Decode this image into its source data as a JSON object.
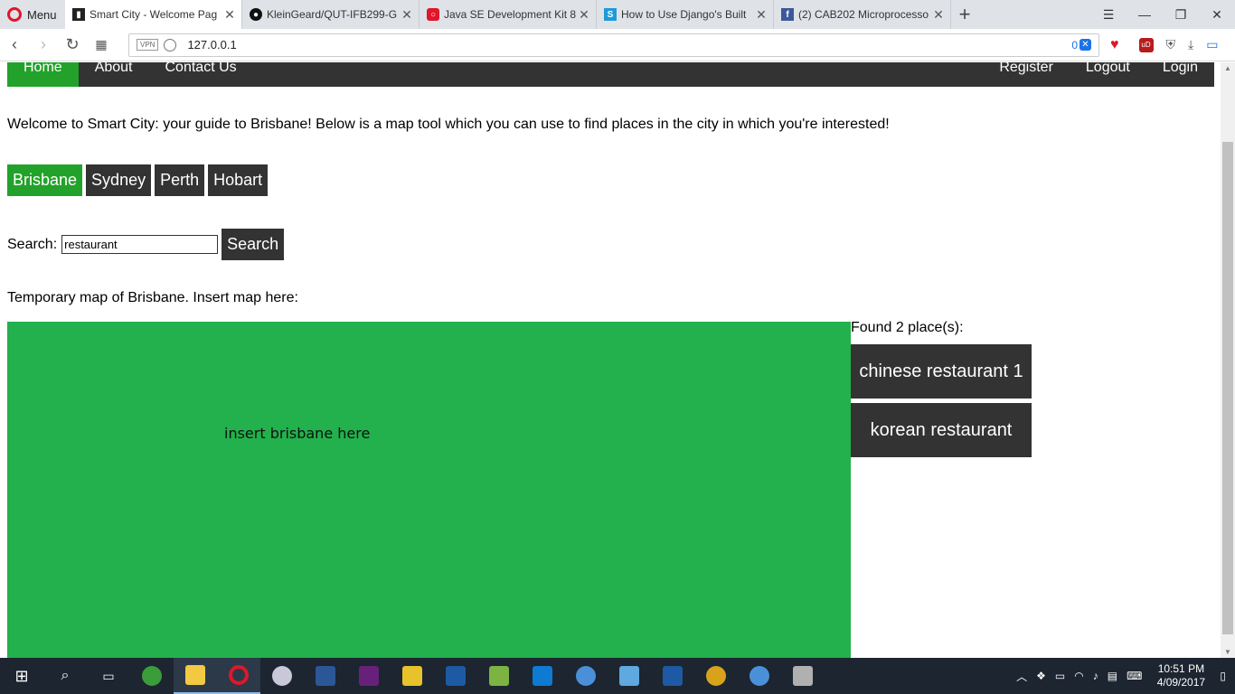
{
  "browser": {
    "menu_label": "Menu",
    "tabs": [
      {
        "title": "Smart City - Welcome Pag",
        "favicon_color": "#222222",
        "active": true
      },
      {
        "title": "KleinGeard/QUT-IFB299-G",
        "favicon_color": "#111111",
        "active": false
      },
      {
        "title": "Java SE Development Kit 8",
        "favicon_color": "#e0162b",
        "active": false
      },
      {
        "title": "How to Use Django's Built",
        "favicon_color": "#1e9bd7",
        "active": false
      },
      {
        "title": "(2) CAB202 Microprocesso",
        "favicon_color": "#3b5998",
        "active": false
      }
    ],
    "url": "127.0.0.1",
    "vpn_label": "VPN",
    "tracker_count": "0"
  },
  "page": {
    "nav": {
      "left": [
        "Home",
        "About",
        "Contact Us"
      ],
      "right": [
        "Register",
        "Logout",
        "Login"
      ]
    },
    "welcome_text": "Welcome to Smart City: your guide to Brisbane! Below is a map tool which you can use to find places in the city in which you're interested!",
    "cities": [
      "Brisbane",
      "Sydney",
      "Perth",
      "Hobart"
    ],
    "active_city": "Brisbane",
    "search": {
      "label": "Search:",
      "value": "restaurant",
      "button": "Search"
    },
    "map_caption": "Temporary map of Brisbane. Insert map here:",
    "map_placeholder": "insert brisbane here",
    "results": {
      "count_text": "Found 2 place(s):",
      "items": [
        "chinese restaurant 1",
        "korean restaurant"
      ]
    }
  },
  "colors": {
    "nav_bg": "#333333",
    "accent_green": "#22a22a",
    "map_green": "#22b14c"
  },
  "taskbar": {
    "time": "10:51 PM",
    "date": "4/09/2017"
  }
}
